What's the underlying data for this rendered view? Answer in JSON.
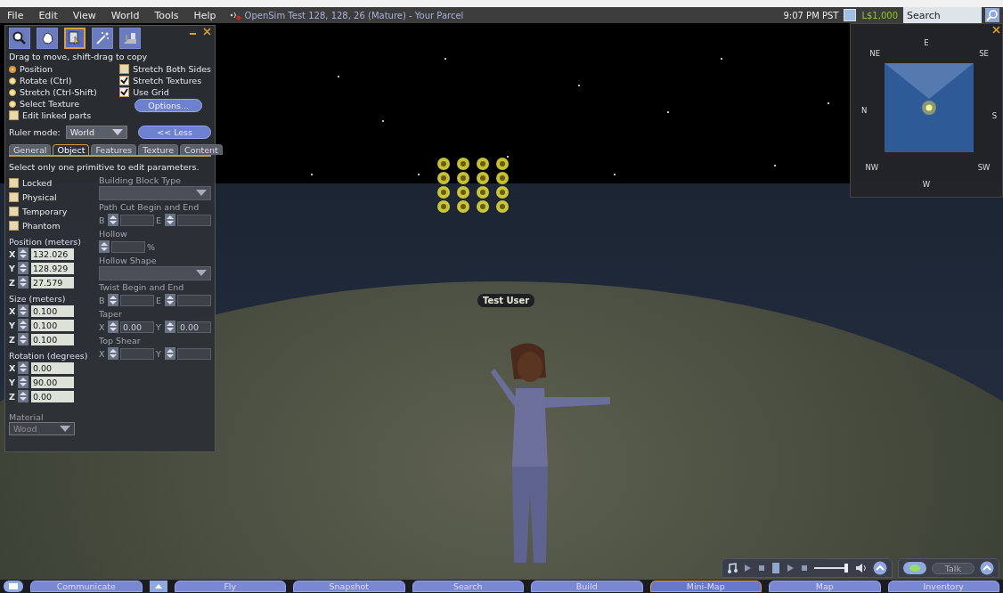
{
  "menu": [
    "File",
    "Edit",
    "View",
    "World",
    "Tools",
    "Help"
  ],
  "location": "OpenSim Test 128, 128, 26 (Mature) - Your Parcel",
  "clock": "9:07 PM PST",
  "balance": "L$1,000",
  "search": {
    "placeholder": "Search"
  },
  "build_panel": {
    "tools": [
      {
        "kind": "focus",
        "selected": false
      },
      {
        "kind": "move",
        "selected": false
      },
      {
        "kind": "edit",
        "selected": true
      },
      {
        "kind": "create",
        "selected": false
      },
      {
        "kind": "land",
        "selected": false
      }
    ],
    "hint": "Drag to move, shift-drag to copy",
    "modes": [
      {
        "label": "Position",
        "selected": true
      },
      {
        "label": "Rotate (Ctrl)",
        "selected": false
      },
      {
        "label": "Stretch (Ctrl-Shift)",
        "selected": false
      },
      {
        "label": "Select Texture",
        "selected": false
      }
    ],
    "options": [
      {
        "label": "Stretch Both Sides",
        "checked": false
      },
      {
        "label": "Stretch Textures",
        "checked": true
      },
      {
        "label": "Use Grid",
        "checked": true
      }
    ],
    "options_button": "Options...",
    "edit_linked": {
      "label": "Edit linked parts",
      "checked": false
    },
    "ruler_mode": {
      "label": "Ruler mode:",
      "value": "World"
    },
    "less_button": "<< Less",
    "tabs": [
      {
        "label": "General",
        "selected": false
      },
      {
        "label": "Object",
        "selected": true
      },
      {
        "label": "Features",
        "selected": false
      },
      {
        "label": "Texture",
        "selected": false
      },
      {
        "label": "Content",
        "selected": false
      }
    ],
    "message": "Select only one primitive to edit parameters.",
    "flags": [
      {
        "label": "Locked",
        "checked": false
      },
      {
        "label": "Physical",
        "checked": false
      },
      {
        "label": "Temporary",
        "checked": false
      },
      {
        "label": "Phantom",
        "checked": false
      }
    ],
    "vectors": [
      {
        "label": "Position (meters)",
        "axes": [
          {
            "axis": "X",
            "value": "132.026"
          },
          {
            "axis": "Y",
            "value": "128.929"
          },
          {
            "axis": "Z",
            "value": "27.579"
          }
        ]
      },
      {
        "label": "Size (meters)",
        "axes": [
          {
            "axis": "X",
            "value": "0.100"
          },
          {
            "axis": "Y",
            "value": "0.100"
          },
          {
            "axis": "Z",
            "value": "0.100"
          }
        ]
      },
      {
        "label": "Rotation (degrees)",
        "axes": [
          {
            "axis": "X",
            "value": "0.00"
          },
          {
            "axis": "Y",
            "value": "90.00"
          },
          {
            "axis": "Z",
            "value": "0.00"
          }
        ]
      }
    ],
    "material": {
      "label": "Material",
      "value": "Wood"
    },
    "shape_params": {
      "disabled": true,
      "rows": [
        {
          "kind": "dropdown",
          "label": "Building Block Type"
        },
        {
          "kind": "pair",
          "label": "Path Cut Begin and End",
          "a": "B",
          "b": "E",
          "a_value": "",
          "b_value": ""
        },
        {
          "kind": "single",
          "label": "Hollow",
          "unit": "%"
        },
        {
          "kind": "dropdown",
          "label": "Hollow Shape"
        },
        {
          "kind": "pair",
          "label": "Twist Begin and End",
          "a": "B",
          "b": "E",
          "a_value": "",
          "b_value": ""
        },
        {
          "kind": "pair",
          "label": "Taper",
          "a": "X",
          "b": "Y",
          "a_value": "0.00",
          "b_value": "0.00"
        },
        {
          "kind": "pair",
          "label": "Top Shear",
          "a": "X",
          "b": "Y",
          "a_value": "",
          "b_value": ""
        }
      ]
    }
  },
  "minimap": {
    "compass": [
      {
        "label": "E"
      },
      {
        "label": "NE"
      },
      {
        "label": "SE"
      },
      {
        "label": "N"
      },
      {
        "label": "S"
      },
      {
        "label": "NW"
      },
      {
        "label": "SW"
      },
      {
        "label": "W"
      }
    ]
  },
  "name_tag": "Test User",
  "talk_button": "Talk",
  "toolbar": [
    {
      "label": "Communicate",
      "selected": false
    },
    {
      "label": "Fly",
      "selected": false
    },
    {
      "label": "Snapshot",
      "selected": false
    },
    {
      "label": "Search",
      "selected": false
    },
    {
      "label": "Build",
      "selected": false
    },
    {
      "label": "Mini-Map",
      "selected": true
    },
    {
      "label": "Map",
      "selected": false
    },
    {
      "label": "Inventory",
      "selected": false
    }
  ]
}
